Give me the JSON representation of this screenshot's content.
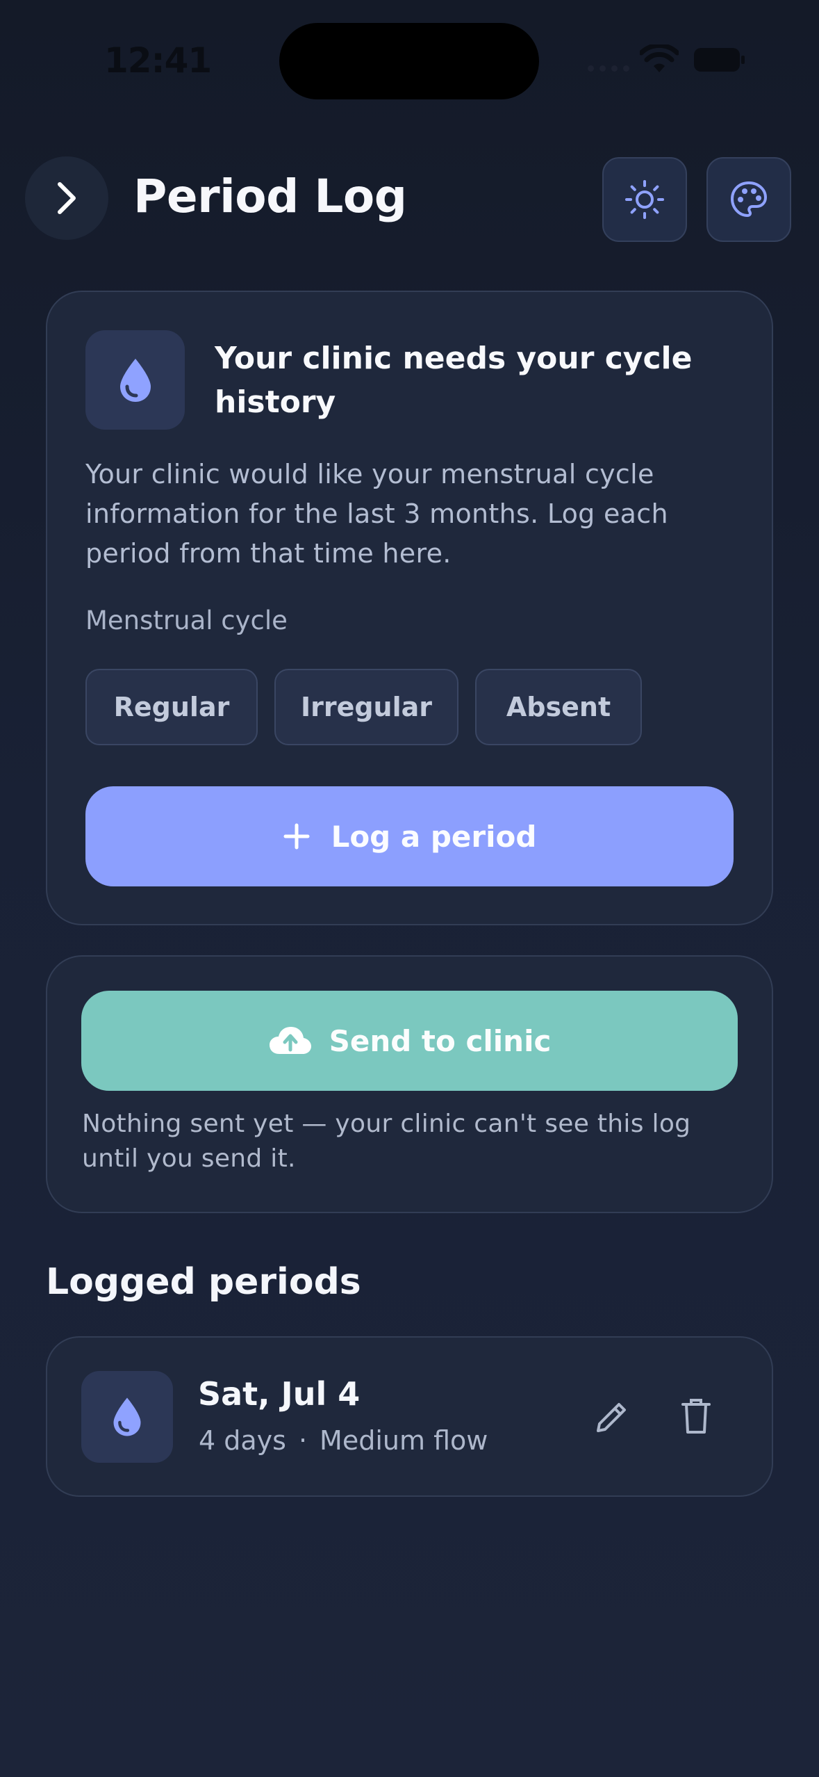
{
  "status_bar": {
    "time": "12:41"
  },
  "header": {
    "title": "Period Log",
    "back_icon": "chevron-right-icon",
    "theme_icon": "sun-icon",
    "palette_icon": "palette-icon"
  },
  "clinic_card": {
    "heading": "Your clinic needs your cycle history",
    "description": "Your clinic would like your menstrual cycle information for the last 3 months. Log each period from that time here.",
    "cycle_label": "Menstrual cycle",
    "options": [
      "Regular",
      "Irregular",
      "Absent"
    ],
    "log_button": "Log a period"
  },
  "send_card": {
    "button": "Send to clinic",
    "note": "Nothing sent yet — your clinic can't see this log until you send it."
  },
  "logged": {
    "section_title": "Logged periods",
    "entries": [
      {
        "date": "Sat, Jul 4",
        "duration": "4 days",
        "separator": "·",
        "flow": "Medium flow"
      }
    ]
  },
  "colors": {
    "accent": "#8c9ffe",
    "send": "#7bc8bf",
    "icon": "#8fa2ff",
    "background": "#192135"
  }
}
